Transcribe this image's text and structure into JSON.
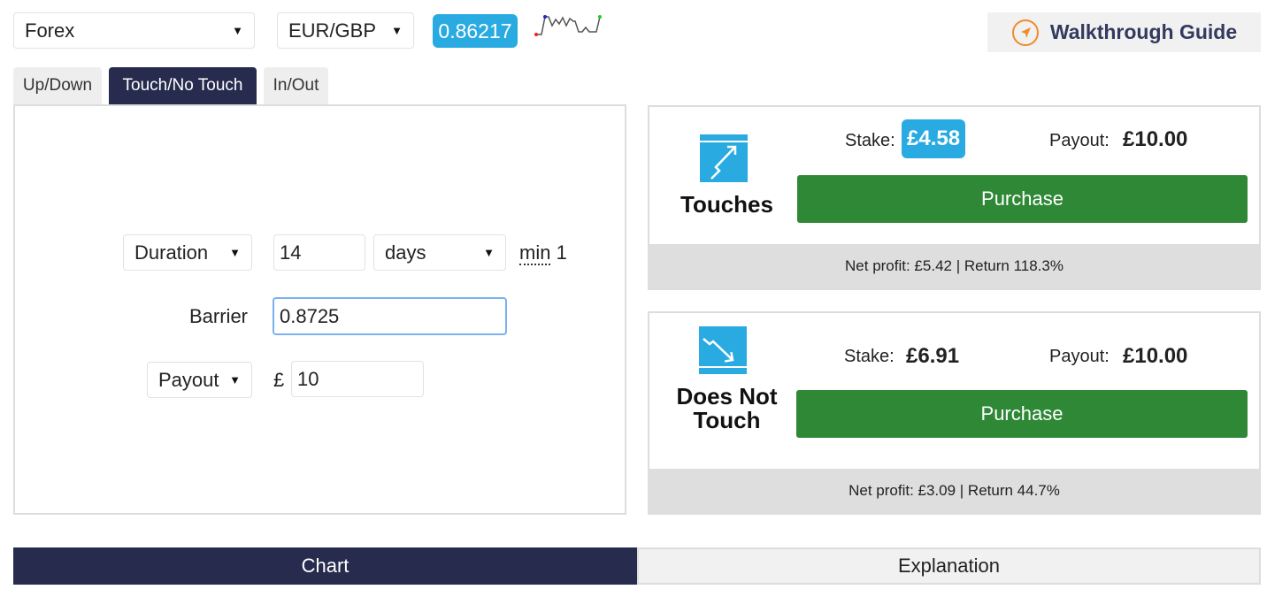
{
  "header": {
    "market": "Forex",
    "symbol": "EUR/GBP",
    "price": "0.86217",
    "guide_label": "Walkthrough Guide"
  },
  "tabs": [
    {
      "label": "Up/Down"
    },
    {
      "label": "Touch/No Touch"
    },
    {
      "label": "In/Out"
    }
  ],
  "form": {
    "duration_type": "Duration",
    "duration_value": "14",
    "duration_unit": "days",
    "min_label": "min",
    "min_value": "1",
    "barrier_label": "Barrier",
    "barrier_value": "0.8725",
    "amount_type": "Payout",
    "currency": "£",
    "amount_value": "10"
  },
  "contracts": [
    {
      "name": "Touches",
      "stake_label": "Stake:",
      "stake": "£4.58",
      "payout_label": "Payout:",
      "payout": "£10.00",
      "button": "Purchase",
      "footer": "Net profit: £5.42 | Return 118.3%"
    },
    {
      "name": "Does Not Touch",
      "stake_label": "Stake:",
      "stake": "£6.91",
      "payout_label": "Payout:",
      "payout": "£10.00",
      "button": "Purchase",
      "footer": "Net profit: £3.09 | Return 44.7%"
    }
  ],
  "bottom_tabs": [
    {
      "label": "Chart"
    },
    {
      "label": "Explanation"
    }
  ],
  "colors": {
    "accent": "#29abe2",
    "nav": "#272c4f",
    "buy": "#2e8836",
    "guide_icon": "#f08c2a"
  }
}
